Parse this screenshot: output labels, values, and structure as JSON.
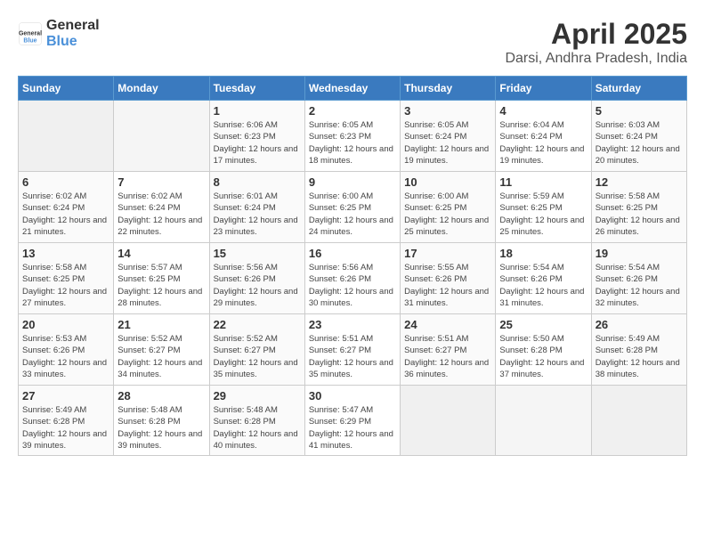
{
  "header": {
    "logo_general": "General",
    "logo_blue": "Blue",
    "month": "April 2025",
    "location": "Darsi, Andhra Pradesh, India"
  },
  "weekdays": [
    "Sunday",
    "Monday",
    "Tuesday",
    "Wednesday",
    "Thursday",
    "Friday",
    "Saturday"
  ],
  "weeks": [
    [
      {
        "day": "",
        "info": ""
      },
      {
        "day": "",
        "info": ""
      },
      {
        "day": "1",
        "info": "Sunrise: 6:06 AM\nSunset: 6:23 PM\nDaylight: 12 hours and 17 minutes."
      },
      {
        "day": "2",
        "info": "Sunrise: 6:05 AM\nSunset: 6:23 PM\nDaylight: 12 hours and 18 minutes."
      },
      {
        "day": "3",
        "info": "Sunrise: 6:05 AM\nSunset: 6:24 PM\nDaylight: 12 hours and 19 minutes."
      },
      {
        "day": "4",
        "info": "Sunrise: 6:04 AM\nSunset: 6:24 PM\nDaylight: 12 hours and 19 minutes."
      },
      {
        "day": "5",
        "info": "Sunrise: 6:03 AM\nSunset: 6:24 PM\nDaylight: 12 hours and 20 minutes."
      }
    ],
    [
      {
        "day": "6",
        "info": "Sunrise: 6:02 AM\nSunset: 6:24 PM\nDaylight: 12 hours and 21 minutes."
      },
      {
        "day": "7",
        "info": "Sunrise: 6:02 AM\nSunset: 6:24 PM\nDaylight: 12 hours and 22 minutes."
      },
      {
        "day": "8",
        "info": "Sunrise: 6:01 AM\nSunset: 6:24 PM\nDaylight: 12 hours and 23 minutes."
      },
      {
        "day": "9",
        "info": "Sunrise: 6:00 AM\nSunset: 6:25 PM\nDaylight: 12 hours and 24 minutes."
      },
      {
        "day": "10",
        "info": "Sunrise: 6:00 AM\nSunset: 6:25 PM\nDaylight: 12 hours and 25 minutes."
      },
      {
        "day": "11",
        "info": "Sunrise: 5:59 AM\nSunset: 6:25 PM\nDaylight: 12 hours and 25 minutes."
      },
      {
        "day": "12",
        "info": "Sunrise: 5:58 AM\nSunset: 6:25 PM\nDaylight: 12 hours and 26 minutes."
      }
    ],
    [
      {
        "day": "13",
        "info": "Sunrise: 5:58 AM\nSunset: 6:25 PM\nDaylight: 12 hours and 27 minutes."
      },
      {
        "day": "14",
        "info": "Sunrise: 5:57 AM\nSunset: 6:25 PM\nDaylight: 12 hours and 28 minutes."
      },
      {
        "day": "15",
        "info": "Sunrise: 5:56 AM\nSunset: 6:26 PM\nDaylight: 12 hours and 29 minutes."
      },
      {
        "day": "16",
        "info": "Sunrise: 5:56 AM\nSunset: 6:26 PM\nDaylight: 12 hours and 30 minutes."
      },
      {
        "day": "17",
        "info": "Sunrise: 5:55 AM\nSunset: 6:26 PM\nDaylight: 12 hours and 31 minutes."
      },
      {
        "day": "18",
        "info": "Sunrise: 5:54 AM\nSunset: 6:26 PM\nDaylight: 12 hours and 31 minutes."
      },
      {
        "day": "19",
        "info": "Sunrise: 5:54 AM\nSunset: 6:26 PM\nDaylight: 12 hours and 32 minutes."
      }
    ],
    [
      {
        "day": "20",
        "info": "Sunrise: 5:53 AM\nSunset: 6:26 PM\nDaylight: 12 hours and 33 minutes."
      },
      {
        "day": "21",
        "info": "Sunrise: 5:52 AM\nSunset: 6:27 PM\nDaylight: 12 hours and 34 minutes."
      },
      {
        "day": "22",
        "info": "Sunrise: 5:52 AM\nSunset: 6:27 PM\nDaylight: 12 hours and 35 minutes."
      },
      {
        "day": "23",
        "info": "Sunrise: 5:51 AM\nSunset: 6:27 PM\nDaylight: 12 hours and 35 minutes."
      },
      {
        "day": "24",
        "info": "Sunrise: 5:51 AM\nSunset: 6:27 PM\nDaylight: 12 hours and 36 minutes."
      },
      {
        "day": "25",
        "info": "Sunrise: 5:50 AM\nSunset: 6:28 PM\nDaylight: 12 hours and 37 minutes."
      },
      {
        "day": "26",
        "info": "Sunrise: 5:49 AM\nSunset: 6:28 PM\nDaylight: 12 hours and 38 minutes."
      }
    ],
    [
      {
        "day": "27",
        "info": "Sunrise: 5:49 AM\nSunset: 6:28 PM\nDaylight: 12 hours and 39 minutes."
      },
      {
        "day": "28",
        "info": "Sunrise: 5:48 AM\nSunset: 6:28 PM\nDaylight: 12 hours and 39 minutes."
      },
      {
        "day": "29",
        "info": "Sunrise: 5:48 AM\nSunset: 6:28 PM\nDaylight: 12 hours and 40 minutes."
      },
      {
        "day": "30",
        "info": "Sunrise: 5:47 AM\nSunset: 6:29 PM\nDaylight: 12 hours and 41 minutes."
      },
      {
        "day": "",
        "info": ""
      },
      {
        "day": "",
        "info": ""
      },
      {
        "day": "",
        "info": ""
      }
    ]
  ]
}
